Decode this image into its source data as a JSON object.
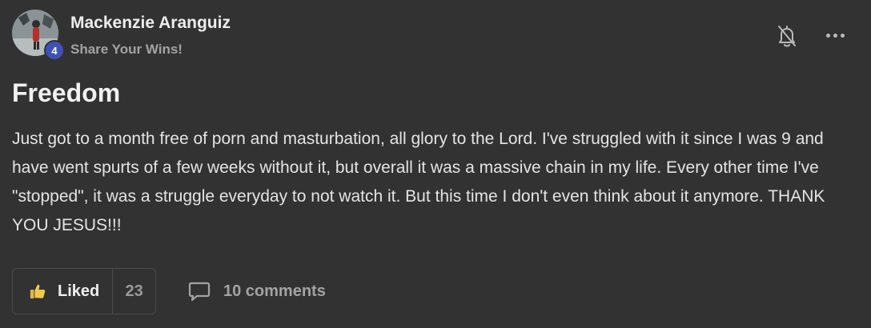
{
  "post": {
    "author": "Mackenzie Aranguiz",
    "level": "4",
    "category": "Share Your Wins!",
    "title": "Freedom",
    "body": "Just got to a month free of porn and masturbation, all glory to the Lord. I've struggled with it since I was 9 and have went spurts of a few weeks without it, but overall it was a massive chain in my life. Every other time I've \"stopped\", it was a struggle everyday to not watch it. But this time I don't even think about it anymore. THANK YOU JESUS!!!"
  },
  "actions": {
    "like_label": "Liked",
    "like_count": "23",
    "comments_label": "10 comments"
  },
  "icons": {
    "bell": "bell-off-icon",
    "more": "more-horizontal-icon",
    "like": "thumbs-up-icon",
    "comment": "comment-bubble-icon"
  },
  "colors": {
    "background": "#323232",
    "badge": "#3f51b5",
    "thumb": "#f2c94c"
  }
}
